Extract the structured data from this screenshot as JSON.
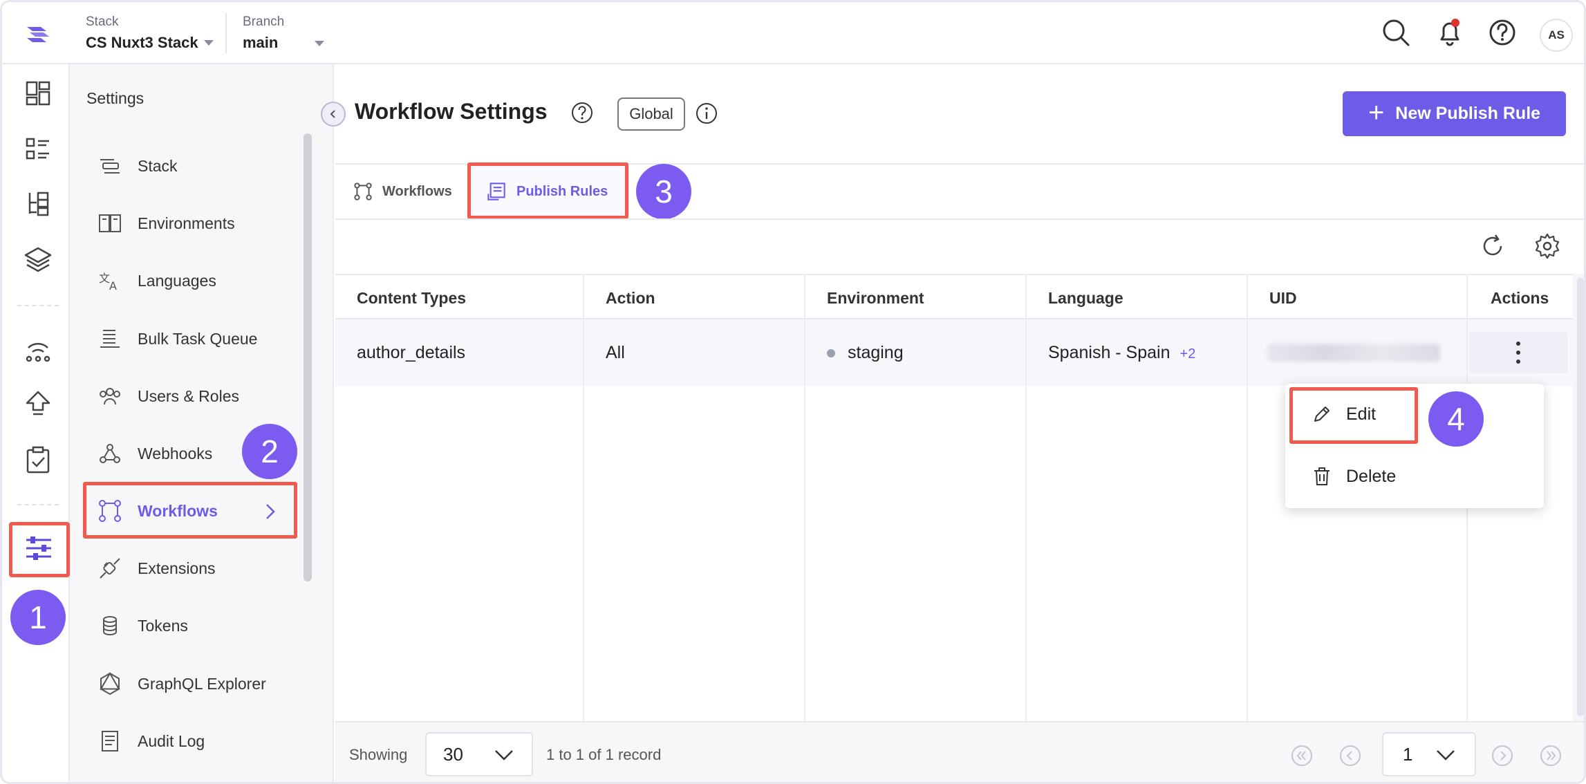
{
  "topbar": {
    "stack_label": "Stack",
    "stack_value": "CS Nuxt3 Stack",
    "branch_label": "Branch",
    "branch_value": "main",
    "avatar_initials": "AS"
  },
  "sidebar": {
    "title": "Settings",
    "items": [
      {
        "label": "Stack",
        "icon": "stack-icon"
      },
      {
        "label": "Environments",
        "icon": "environments-icon"
      },
      {
        "label": "Languages",
        "icon": "languages-icon"
      },
      {
        "label": "Bulk Task Queue",
        "icon": "bulk-task-queue-icon"
      },
      {
        "label": "Users & Roles",
        "icon": "users-roles-icon"
      },
      {
        "label": "Webhooks",
        "icon": "webhooks-icon"
      },
      {
        "label": "Workflows",
        "icon": "workflows-icon"
      },
      {
        "label": "Extensions",
        "icon": "extensions-icon"
      },
      {
        "label": "Tokens",
        "icon": "tokens-icon"
      },
      {
        "label": "GraphQL Explorer",
        "icon": "graphql-icon"
      },
      {
        "label": "Audit Log",
        "icon": "audit-log-icon"
      }
    ]
  },
  "header": {
    "title": "Workflow Settings",
    "scope_pill": "Global",
    "new_rule_button": "New Publish Rule"
  },
  "tabs": [
    {
      "label": "Workflows",
      "active": false
    },
    {
      "label": "Publish Rules",
      "active": true
    }
  ],
  "table": {
    "columns": [
      "Content Types",
      "Action",
      "Environment",
      "Language",
      "UID",
      "Actions"
    ],
    "rows": [
      {
        "content_type": "author_details",
        "action": "All",
        "environment": "staging",
        "language": "Spanish - Spain",
        "language_more": "+2"
      }
    ]
  },
  "row_menu": {
    "items": [
      "Edit",
      "Delete"
    ]
  },
  "footer": {
    "showing_label": "Showing",
    "page_size": "30",
    "record_text": "1 to 1 of 1 record",
    "current_page": "1"
  },
  "badges": [
    "1",
    "2",
    "3",
    "4"
  ],
  "colors": {
    "accent": "#6c5ce7",
    "highlight": "#f05a4f",
    "badge": "#7c5cf0"
  }
}
